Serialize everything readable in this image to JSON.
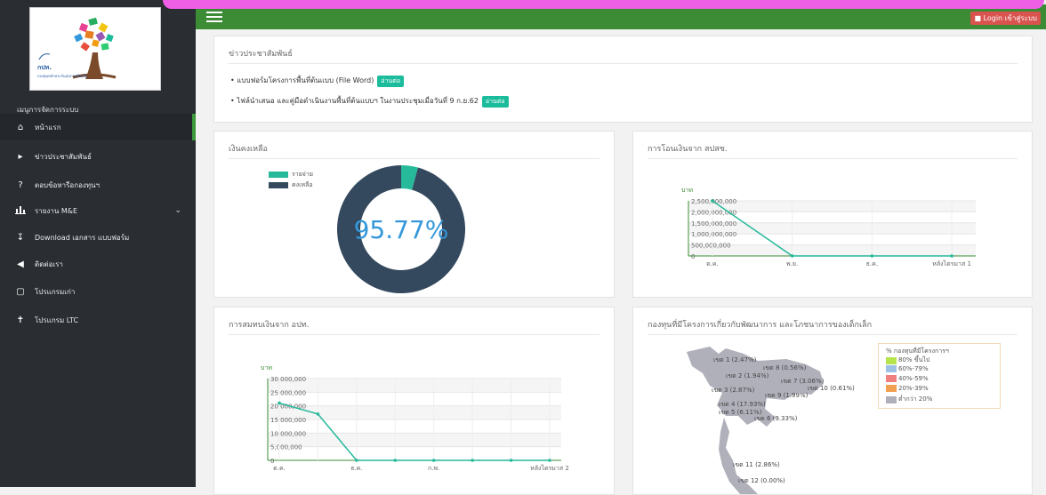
{
  "sidebar": {
    "menu_title": "เมนูการจัดการระบบ",
    "logo": {
      "abbr": "กปท.",
      "text": "กองทุนหลักประกันสุขภาพท้องถิ่น"
    },
    "items": [
      {
        "label": "หน้าแรก",
        "icon": "home-icon"
      },
      {
        "label": "ข่าวประชาสัมพันธ์",
        "icon": "bullhorn-icon"
      },
      {
        "label": "ตอบข้อหารือกองทุนฯ",
        "icon": "question-icon"
      },
      {
        "label": "รายงาน M&E",
        "icon": "bar-chart-icon"
      },
      {
        "label": "Download เอกสาร แบบฟอร์ม",
        "icon": "download-icon"
      },
      {
        "label": "ติดต่อเรา",
        "icon": "share-icon"
      },
      {
        "label": "โปรแกรมเก่า",
        "icon": "window-icon"
      },
      {
        "label": "โปรแกรม LTC",
        "icon": "person-icon"
      }
    ]
  },
  "header": {
    "login_label": "Login เข้าสู่ระบบ"
  },
  "news": {
    "title": "ข่าวประชาสัมพันธ์",
    "items": [
      {
        "text": "• แบบฟอร์มโครงการพื้นที่ต้นแบบ (File Word)",
        "button": "อ่านต่อ"
      },
      {
        "text": "• ไฟล์นำเสนอ และคู่มือดำเนินงานพื้นที่ต้นแบบฯ ในงานประชุมเมื่อวันที่ 9 ก.ย.62",
        "button": "อ่านต่อ"
      }
    ]
  },
  "balance": {
    "title": "เงินคงเหลือ",
    "colors": {
      "spend": "#26b99a",
      "remain": "#34495e",
      "center": "#3498db"
    },
    "chart_data": {
      "type": "pie",
      "categories": [
        "รายจ่าย",
        "คงเหลือ"
      ],
      "values": [
        4.23,
        95.77
      ],
      "center_label": "95.77%"
    }
  },
  "transfer": {
    "title": "การโอนเงินจาก สปสช.",
    "chart_data": {
      "type": "line",
      "ylabel": "บาท",
      "categories": [
        "ต.ค.",
        "พ.ย.",
        "ธ.ค.",
        "หลังไตรมาส 1"
      ],
      "values": [
        2500000000,
        0,
        0,
        0
      ],
      "ylim": [
        0,
        2500000000
      ],
      "yticks": [
        "2,500,000,000",
        "2,000,000,000",
        "1,500,000,000",
        "1,000,000,000",
        "500,000,000",
        "0"
      ],
      "grid": true
    }
  },
  "contrib": {
    "title": "การสมทบเงินจาก อปท.",
    "chart_data": {
      "type": "line",
      "ylabel": "บาท",
      "categories": [
        "ต.ค.",
        "",
        "ธ.ค.",
        "",
        "ก.พ.",
        "",
        "",
        "หลังไตรมาส 2"
      ],
      "values": [
        21000000,
        17000000,
        0,
        0,
        0,
        0,
        0,
        0
      ],
      "ylim": [
        0,
        30000000
      ],
      "yticks": [
        "30,000,000",
        "25,000,000",
        "20,000,000",
        "15,000,000",
        "10,000,000",
        "5,000,000",
        "0"
      ],
      "grid": true
    }
  },
  "childfund": {
    "title": "กองทุนที่มีโครงการเกี่ยวกับพัฒนาการ และโภชนาการของเด็กเล็ก",
    "legend_title": "% กองทุนที่มีโครงการฯ",
    "legend": [
      {
        "label": "80% ขึ้นไป",
        "color": "#b7e34d"
      },
      {
        "label": "60%-79%",
        "color": "#9ec2e6"
      },
      {
        "label": "40%-59%",
        "color": "#f08080"
      },
      {
        "label": "20%-39%",
        "color": "#f0a050"
      },
      {
        "label": "ต่ำกว่า 20%",
        "color": "#b0b0bb"
      }
    ],
    "regions": [
      "เขต 1 (2.47%)",
      "เขต 8 (0.56%)",
      "เขต 2 (1.94%)",
      "เขต 7 (3.06%)",
      "เขต 3 (2.87%)",
      "เขต 9 (1.99%)",
      "เขต 10 (0.61%)",
      "เขต 4 (17.93%)",
      "เขต 5 (6.11%)",
      "เขต 6 (9.33%)",
      "เขต 11 (2.86%)",
      "เขต 12 (0.00%)"
    ]
  }
}
